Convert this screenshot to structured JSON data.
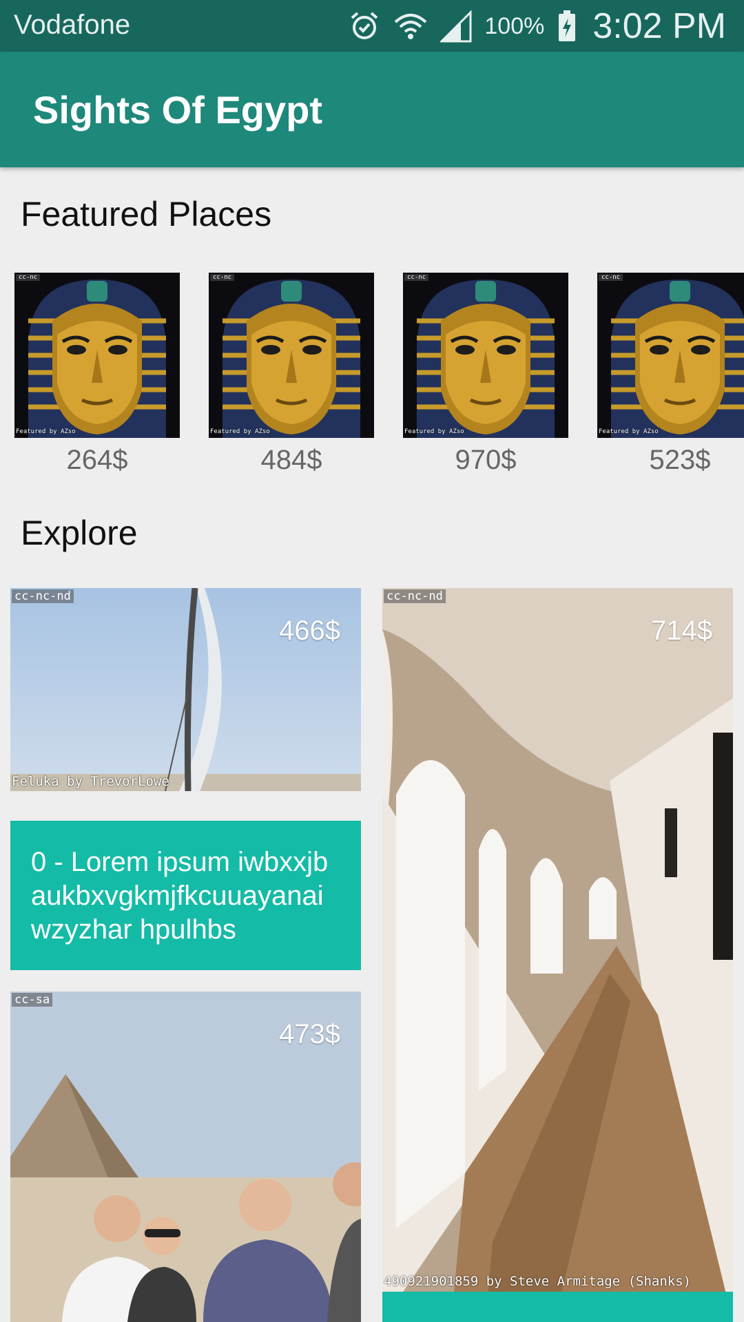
{
  "status_bar": {
    "carrier": "Vodafone",
    "battery": "100%",
    "time": "3:02 PM",
    "icons": [
      "alarm-icon",
      "wifi-icon",
      "signal-icon",
      "battery-charging-icon"
    ]
  },
  "app_bar": {
    "title": "Sights Of Egypt",
    "color": "#1e887b"
  },
  "featured": {
    "heading": "Featured Places",
    "items": [
      {
        "price": "264$",
        "license": "cc-nc",
        "credit": "Featured by AZso"
      },
      {
        "price": "484$",
        "license": "cc-nc",
        "credit": "Featured by AZso"
      },
      {
        "price": "970$",
        "license": "cc-nc",
        "credit": "Featured by AZso"
      },
      {
        "price": "523$",
        "license": "cc-nc",
        "credit": "Featured by AZso"
      }
    ]
  },
  "explore": {
    "heading": "Explore",
    "accent": "#14bba6",
    "cards": [
      {
        "price": "466$",
        "license": "cc-nc-nd",
        "credit": "Feluka by TrevorLowe",
        "caption": "0 - Lorem ipsum iwbxxjbaukbxvgkmjfkcuuayanaiwzyzhar hpulhbs"
      },
      {
        "price": "714$",
        "license": "cc-nc-nd",
        "credit": "490921901859 by Steve Armitage (Shanks)"
      },
      {
        "price": "473$",
        "license": "cc-sa"
      }
    ]
  }
}
